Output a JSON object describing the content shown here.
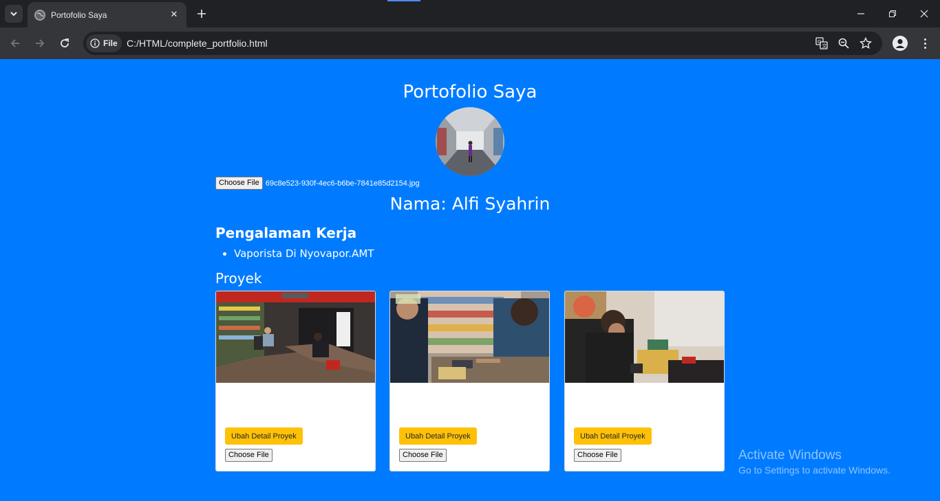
{
  "browser": {
    "tab_title": "Portofolio Saya",
    "omnibox_chip": "File",
    "url": "C:/HTML/complete_portfolio.html"
  },
  "page": {
    "title": "Portofolio Saya",
    "profile_file_button": "Choose File",
    "profile_file_name": "69c8e523-930f-4ec6-b6be-7841e85d2154.jpg",
    "name_heading": "Nama: Alfi Syahrin",
    "experience_heading": "Pengalaman Kerja",
    "experience_items": [
      "Vaporista Di Nyovapor.AMT"
    ],
    "projects_heading": "Proyek",
    "projects": [
      {
        "edit_button": "Ubah Detail Proyek",
        "file_button": "Choose File"
      },
      {
        "edit_button": "Ubah Detail Proyek",
        "file_button": "Choose File"
      },
      {
        "edit_button": "Ubah Detail Proyek",
        "file_button": "Choose File"
      }
    ]
  },
  "watermark": {
    "line1": "Activate Windows",
    "line2": "Go to Settings to activate Windows."
  },
  "colors": {
    "page_background": "#007bff",
    "edit_button": "#ffc107",
    "chrome_dark": "#202124",
    "chrome_toolbar": "#35363a"
  }
}
